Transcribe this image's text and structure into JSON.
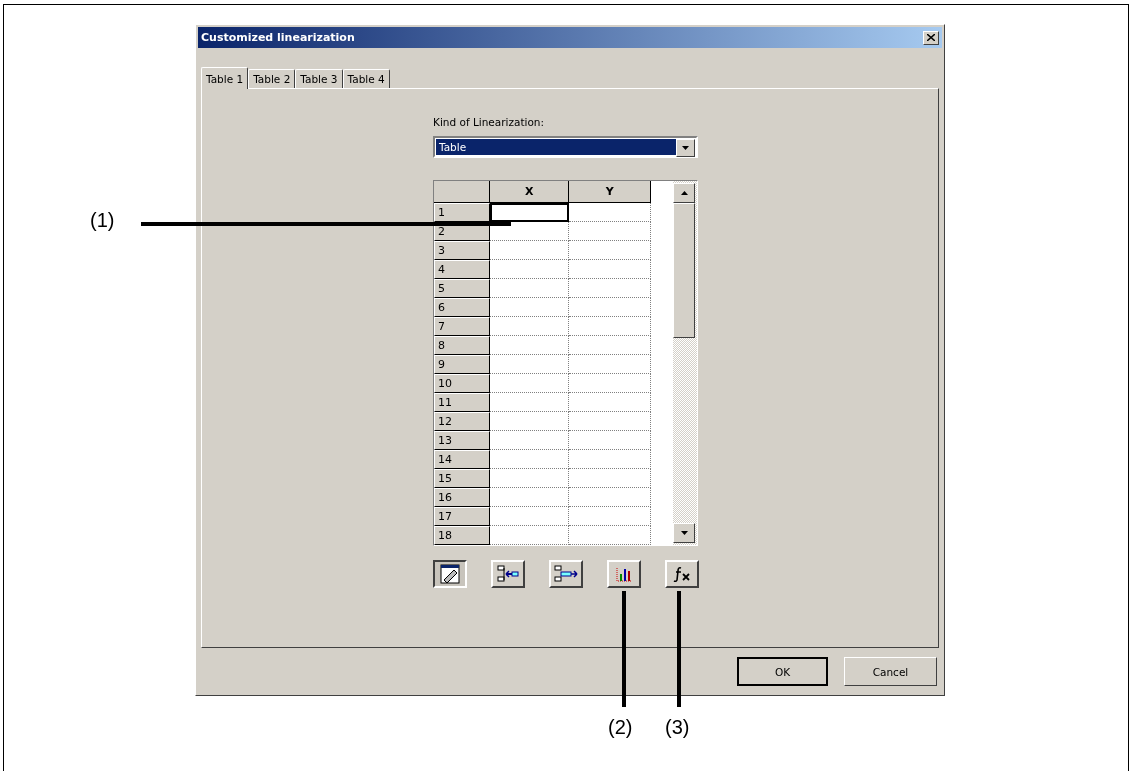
{
  "dialog": {
    "title": "Customized linearization",
    "tabs": [
      {
        "label": "Table 1",
        "selected": true
      },
      {
        "label": "Table 2",
        "selected": false
      },
      {
        "label": "Table 3",
        "selected": false
      },
      {
        "label": "Table 4",
        "selected": false
      }
    ],
    "kind_label": "Kind of Linearization:",
    "kind_dropdown": {
      "value": "Table"
    },
    "table": {
      "columns": [
        "X",
        "Y"
      ],
      "rows": [
        {
          "header": "1",
          "focused": true
        },
        {
          "header": "2",
          "focused": false
        },
        {
          "header": "3",
          "focused": false
        },
        {
          "header": "4",
          "focused": false
        },
        {
          "header": "5",
          "focused": false
        },
        {
          "header": "6",
          "focused": false
        },
        {
          "header": "7",
          "focused": false
        },
        {
          "header": "8",
          "focused": false
        },
        {
          "header": "9",
          "focused": false
        },
        {
          "header": "10",
          "focused": false
        },
        {
          "header": "11",
          "focused": false
        },
        {
          "header": "12",
          "focused": false
        },
        {
          "header": "13",
          "focused": false
        },
        {
          "header": "14",
          "focused": false
        },
        {
          "header": "15",
          "focused": false
        },
        {
          "header": "16",
          "focused": false
        },
        {
          "header": "17",
          "focused": false
        },
        {
          "header": "18",
          "focused": false
        }
      ]
    },
    "toolbar": [
      {
        "kind": "edit",
        "pressed": true
      },
      {
        "kind": "import",
        "pressed": false
      },
      {
        "kind": "export",
        "pressed": false
      },
      {
        "kind": "chart",
        "pressed": false
      },
      {
        "kind": "formula",
        "pressed": false
      }
    ],
    "buttons": [
      {
        "label": "OK",
        "default": true
      },
      {
        "label": "Cancel",
        "default": false
      }
    ]
  },
  "callouts": [
    {
      "label": "(1)",
      "kind": "horizontal"
    },
    {
      "label": "(2)",
      "kind": "vertical"
    },
    {
      "label": "(3)",
      "kind": "vertical"
    }
  ]
}
